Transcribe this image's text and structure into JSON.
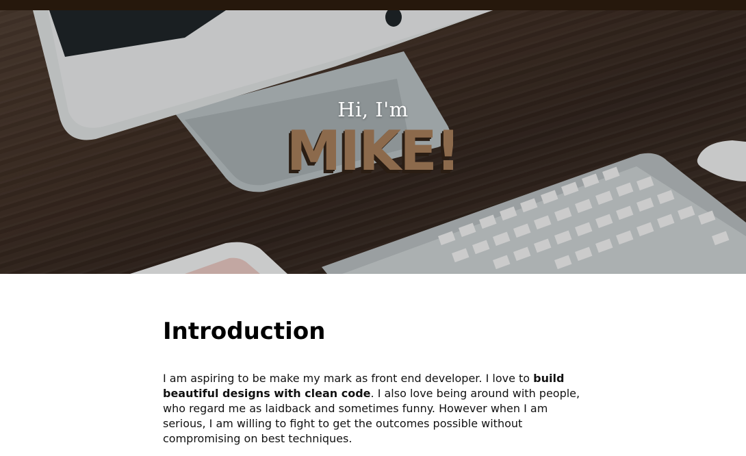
{
  "hero": {
    "greeting": "Hi, I'm",
    "name": "MIKE!"
  },
  "main": {
    "section_title": "Introduction",
    "intro": {
      "part1": "I am aspiring to be make my mark as front end developer. I love to ",
      "bold": "build beautiful designs with clean code",
      "part2": ". I also love being around with people, who regard me as laidback and sometimes funny. However when I am serious, I am willing to fight to get the outcomes possible without compromising on best techniques."
    }
  },
  "colors": {
    "top_bar": "#26180c",
    "name_fill": "#8c6a4c",
    "name_shadow": "#2a1d13"
  }
}
